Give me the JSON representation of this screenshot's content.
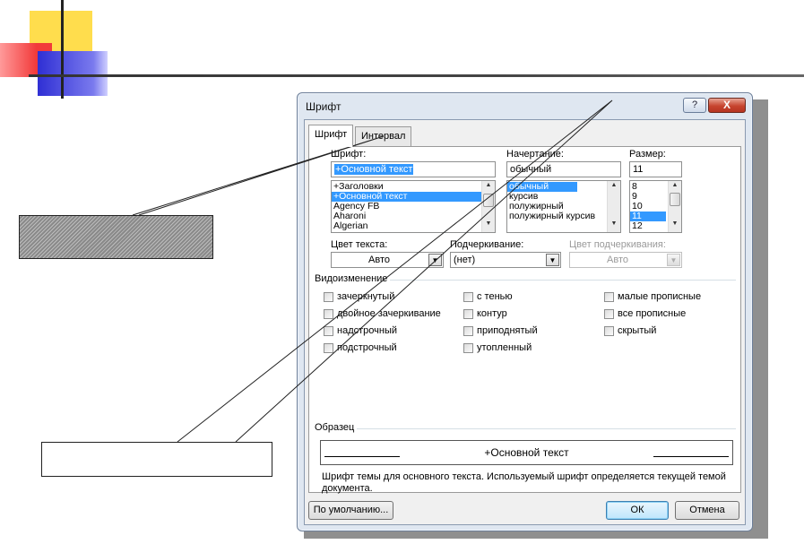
{
  "dialog": {
    "title": "Шрифт",
    "help_label": "?",
    "close_label": "X",
    "tabs": [
      {
        "label": "Шрифт",
        "active": true
      },
      {
        "label": "Интервал",
        "active": false
      }
    ],
    "font": {
      "label": "Шрифт:",
      "value": "+Основной текст",
      "items": [
        "+Заголовки",
        "+Основной текст",
        "Agency FB",
        "Aharoni",
        "Algerian"
      ],
      "selected_index": 1
    },
    "style": {
      "label": "Начертание:",
      "value": "обычный",
      "items": [
        "обычный",
        "курсив",
        "полужирный",
        "полужирный курсив"
      ],
      "selected_index": 0
    },
    "size": {
      "label": "Размер:",
      "value": "11",
      "items": [
        "8",
        "9",
        "10",
        "11",
        "12"
      ],
      "selected_index": 3
    },
    "font_color": {
      "label": "Цвет текста:",
      "value": "Авто"
    },
    "underline": {
      "label": "Подчеркивание:",
      "value": "(нет)"
    },
    "underline_color": {
      "label": "Цвет подчеркивания:",
      "value": "Авто"
    },
    "effects": {
      "title": "Видоизменение",
      "col1": [
        "зачеркнутый",
        "двойное зачеркивание",
        "надстрочный",
        "подстрочный"
      ],
      "col2": [
        "с тенью",
        "контур",
        "приподнятый",
        "утопленный"
      ],
      "col3": [
        "малые прописные",
        "все прописные",
        "скрытый"
      ]
    },
    "preview": {
      "title": "Образец",
      "text": "+Основной текст",
      "description": "Шрифт темы для основного текста. Используемый шрифт определяется текущей темой документа."
    },
    "buttons": {
      "default": "По умолчанию...",
      "ok": "ОК",
      "cancel": "Отмена"
    }
  },
  "colors": {
    "selection": "#3399ff",
    "dialog_frame": "#dfe7f1",
    "close_button": "#c7442f",
    "deco_yellow": "#ffd93a",
    "deco_red": "#f23a3a",
    "deco_blue": "#2f2fd4"
  }
}
